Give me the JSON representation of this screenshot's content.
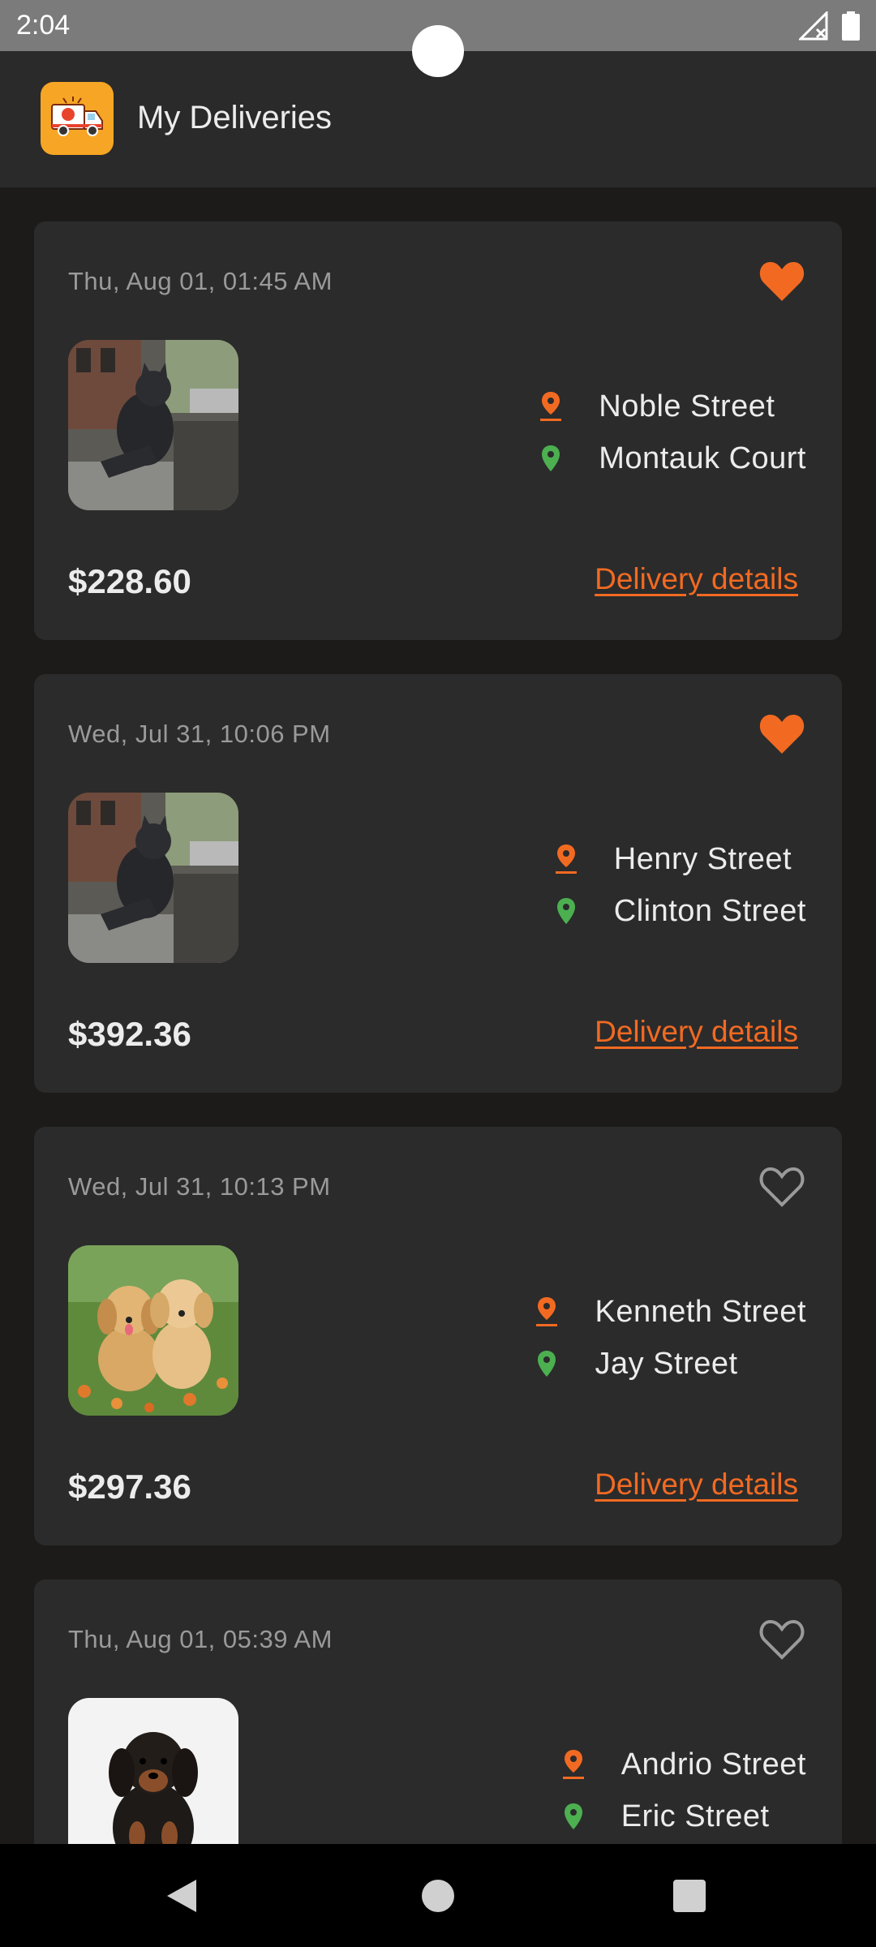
{
  "status_bar": {
    "time": "2:04",
    "signal_icon": "signal-no-data-icon",
    "battery_icon": "battery-full-icon"
  },
  "app_bar": {
    "title": "My Deliveries",
    "logo_icon": "delivery-truck-icon",
    "logo_color": "#f6a624"
  },
  "colors": {
    "accent": "#f26a22",
    "pickup_pin": "#f26a22",
    "dropoff_pin": "#4caf50"
  },
  "deliveries": [
    {
      "date": "Thu, Aug 01, 01:45 AM",
      "favorite": true,
      "image": "cat-statue-photo",
      "from": "Noble Street",
      "to": "Montauk Court",
      "price": "$228.60",
      "link": "Delivery details"
    },
    {
      "date": "Wed, Jul 31, 10:06 PM",
      "favorite": true,
      "image": "cat-statue-photo",
      "from": "Henry Street",
      "to": "Clinton Street",
      "price": "$392.36",
      "link": "Delivery details"
    },
    {
      "date": "Wed, Jul 31, 10:13 PM",
      "favorite": false,
      "image": "golden-puppies-photo",
      "from": "Kenneth Street",
      "to": "Jay Street",
      "price": "$297.36",
      "link": "Delivery details"
    },
    {
      "date": "Thu, Aug 01, 05:39 AM",
      "favorite": false,
      "image": "dachshund-puppy-photo",
      "from": "Andrio Street",
      "to": "Eric Street",
      "price": "",
      "link": ""
    }
  ],
  "nav_bar": {
    "back_icon": "back-triangle-icon",
    "home_icon": "home-circle-icon",
    "recents_icon": "recents-square-icon"
  }
}
